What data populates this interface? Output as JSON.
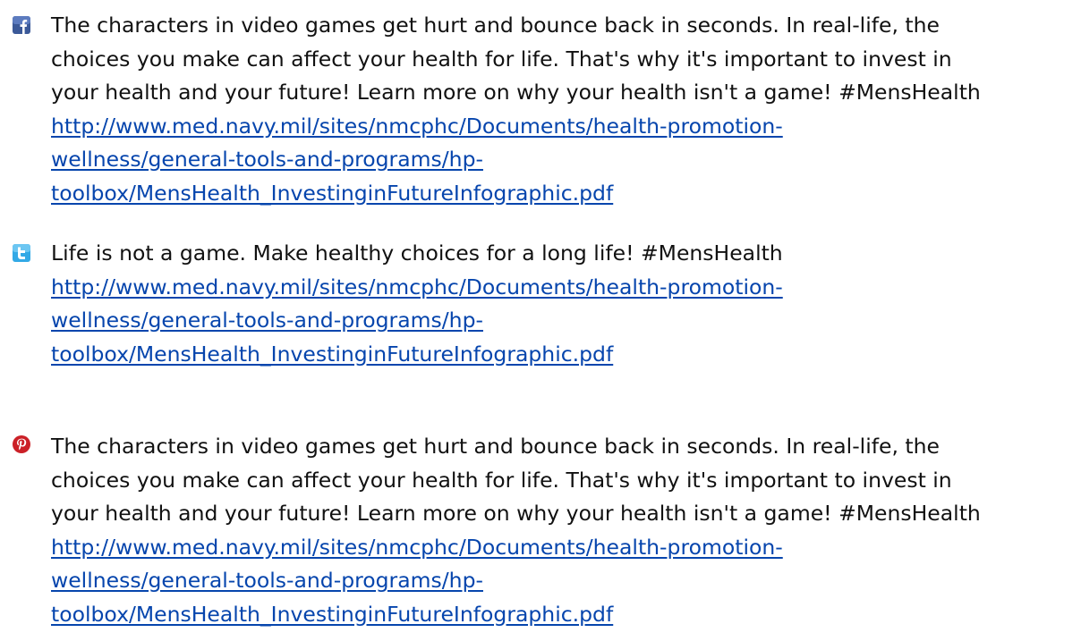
{
  "posts": [
    {
      "platform_icon": "facebook-icon",
      "text_lines": [
        "The characters in video games get hurt and bounce back in seconds. In real-life, the",
        "choices you make can affect your health for life. That's why it's important to invest in",
        "your health and your future! Learn more on why your health isn't a game! #MensHealth"
      ],
      "link_lines": [
        "http://www.med.navy.mil/sites/nmcphc/Documents/health-promotion-",
        "wellness/general-tools-and-programs/hp-",
        "toolbox/MensHealth_InvestinginFutureInfographic.pdf"
      ]
    },
    {
      "platform_icon": "twitter-icon",
      "text_lines": [
        "Life is not a game. Make healthy choices for a long life! #MensHealth"
      ],
      "link_lines": [
        "http://www.med.navy.mil/sites/nmcphc/Documents/health-promotion-",
        "wellness/general-tools-and-programs/hp-",
        "toolbox/MensHealth_InvestinginFutureInfographic.pdf"
      ]
    },
    {
      "platform_icon": "pinterest-icon",
      "text_lines": [
        "The characters in video games get hurt and bounce back in seconds. In real-life, the",
        "choices you make can affect your health for life. That's why it's important to invest in",
        "your health and your future! Learn more on why your health isn't a game! #MensHealth"
      ],
      "link_lines": [
        "http://www.med.navy.mil/sites/nmcphc/Documents/health-promotion-",
        "wellness/general-tools-and-programs/hp-",
        "toolbox/MensHealth_InvestinginFutureInfographic.pdf"
      ]
    }
  ],
  "colors": {
    "text": "#111111",
    "link": "#0645ad",
    "facebook": "#3b5998",
    "twitter": "#33a9e6",
    "pinterest": "#cb2027"
  }
}
